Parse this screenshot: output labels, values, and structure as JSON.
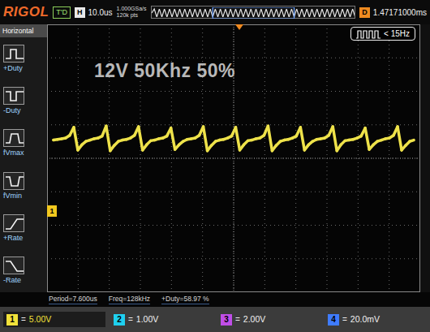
{
  "brand": "RIGOL",
  "top_bar": {
    "run_state": "T'D",
    "timebase_label": "H",
    "timebase": "10.0us",
    "sample_rate": "1.000GSa/s",
    "memory_depth": "120k pts",
    "delay_label": "D",
    "delay": "1.47171000ms"
  },
  "menu": {
    "title": "Horizontal",
    "items": [
      {
        "label": "+Duty",
        "kind": "pos-duty"
      },
      {
        "label": "-Duty",
        "kind": "neg-duty"
      },
      {
        "label": "fVmax",
        "kind": "vmax"
      },
      {
        "label": "fVmin",
        "kind": "vmin"
      },
      {
        "label": "+Rate",
        "kind": "pos-rate"
      },
      {
        "label": "-Rate",
        "kind": "neg-rate"
      }
    ]
  },
  "overlay_text": "12V 50Khz 50%",
  "trigger_badge": {
    "text": "< 15Hz"
  },
  "chart": {
    "ground_label": "1",
    "series": [
      {
        "values": [
          10.6,
          10.7,
          10.8,
          10.9,
          11.3,
          12.5,
          9.1,
          9.9,
          10.4,
          10.6,
          10.8,
          10.9,
          11.2,
          12.7,
          9.0,
          9.8,
          10.4,
          10.6,
          10.7,
          10.9,
          11.3,
          12.6,
          9.1,
          9.9,
          10.5,
          10.6,
          10.8,
          10.9,
          11.2,
          12.4,
          9.2,
          9.9,
          10.4,
          10.7,
          10.8,
          10.9,
          11.3,
          12.6,
          9.0,
          9.8,
          10.4,
          10.6,
          10.7,
          10.9,
          11.2,
          12.5,
          9.1,
          9.9,
          10.5,
          10.6,
          10.8,
          10.9,
          11.3,
          12.7,
          9.0,
          9.8,
          10.4,
          10.6,
          10.7,
          10.9,
          11.2,
          12.5,
          9.1,
          9.9,
          10.4,
          10.7,
          10.8,
          10.9,
          11.3,
          12.6,
          9.0,
          9.9,
          10.5,
          10.6,
          10.7,
          10.9,
          11.2,
          12.4,
          9.2,
          9.9,
          10.4,
          10.6,
          10.8,
          10.9,
          11.3,
          12.6,
          9.1,
          9.8,
          10.4,
          10.6
        ]
      }
    ]
  },
  "measurements": [
    {
      "text": "Period=7.600us"
    },
    {
      "text": "Freq=128kHz"
    },
    {
      "text": "+Duty=58.97 %"
    }
  ],
  "channels": [
    {
      "number": "1",
      "coupling": "=",
      "scale": "5.00V",
      "selected": true,
      "color": "#f2e23a"
    },
    {
      "number": "2",
      "coupling": "=",
      "scale": "1.00V",
      "selected": false,
      "color": "#1fd0f0"
    },
    {
      "number": "3",
      "coupling": "=",
      "scale": "2.00V",
      "selected": false,
      "color": "#c04ee8"
    },
    {
      "number": "4",
      "coupling": "=",
      "scale": "20.0mV",
      "selected": false,
      "color": "#3f7cff"
    }
  ]
}
